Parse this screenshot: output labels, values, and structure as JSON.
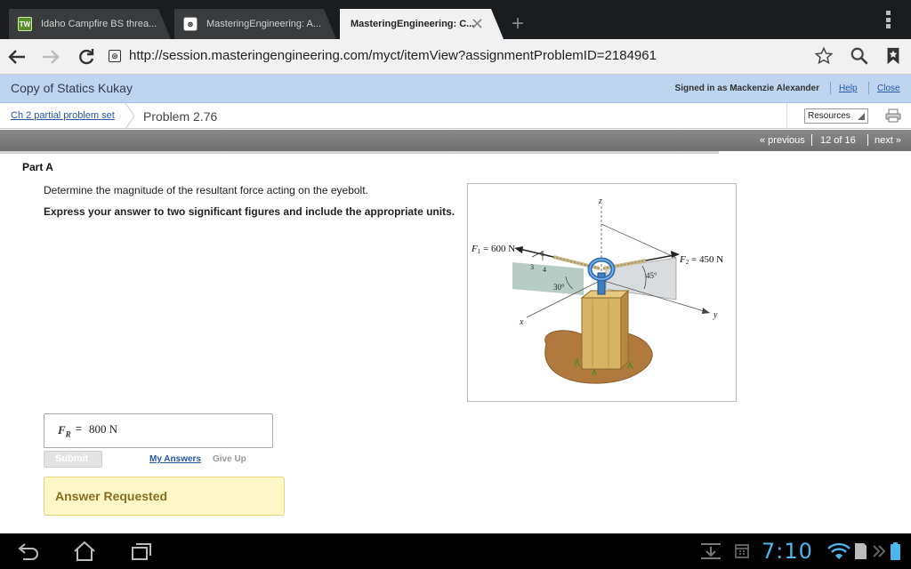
{
  "browser": {
    "tabs": [
      {
        "title": "Idaho Campfire BS threa...",
        "active": false,
        "favicon": "tw-favicon"
      },
      {
        "title": "MasteringEngineering: A...",
        "active": false,
        "favicon": "mastering-favicon"
      },
      {
        "title": "MasteringEngineering: C...",
        "active": true,
        "favicon": "none"
      }
    ],
    "new_tab_glyph": "+",
    "close_glyph": "✕",
    "url": "http://session.masteringengineering.com/myct/itemView?assignmentProblemID=2184961"
  },
  "course_header": {
    "title": "Copy of Statics Kukay",
    "signed_in": "Signed in as Mackenzie Alexander",
    "help": "Help",
    "close": "Close",
    "color": "#bed4ef"
  },
  "breadcrumb": {
    "parent": "Ch 2 partial problem set",
    "current": "Problem 2.76",
    "resources": "Resources"
  },
  "pager": {
    "previous": "« previous",
    "position": "12 of 16",
    "next": "next »"
  },
  "problem": {
    "part_title": "Part A",
    "question": "Determine the magnitude of the resultant force acting on the eyebolt.",
    "instruction": "Express your answer to two significant figures and include the appropriate units."
  },
  "figure": {
    "f1_label": "F",
    "f1_sub": "1",
    "f1_value": " = 600 N",
    "f2_label": "F",
    "f2_sub": "2",
    "f2_value": " = 450 N",
    "axis_x": "x",
    "axis_y": "y",
    "axis_z": "z",
    "slope_3": "3",
    "slope_4": "4",
    "slope_5": "5",
    "angle_30": "30°",
    "angle_45": "45°"
  },
  "answer": {
    "label": "F",
    "label_sub": "R",
    "equals": "=",
    "value": "800 N",
    "submit": "Submit",
    "my_answers": "My Answers",
    "give_up": "Give Up",
    "status": "Answer Requested"
  },
  "system_bar": {
    "clock": "7:10"
  }
}
